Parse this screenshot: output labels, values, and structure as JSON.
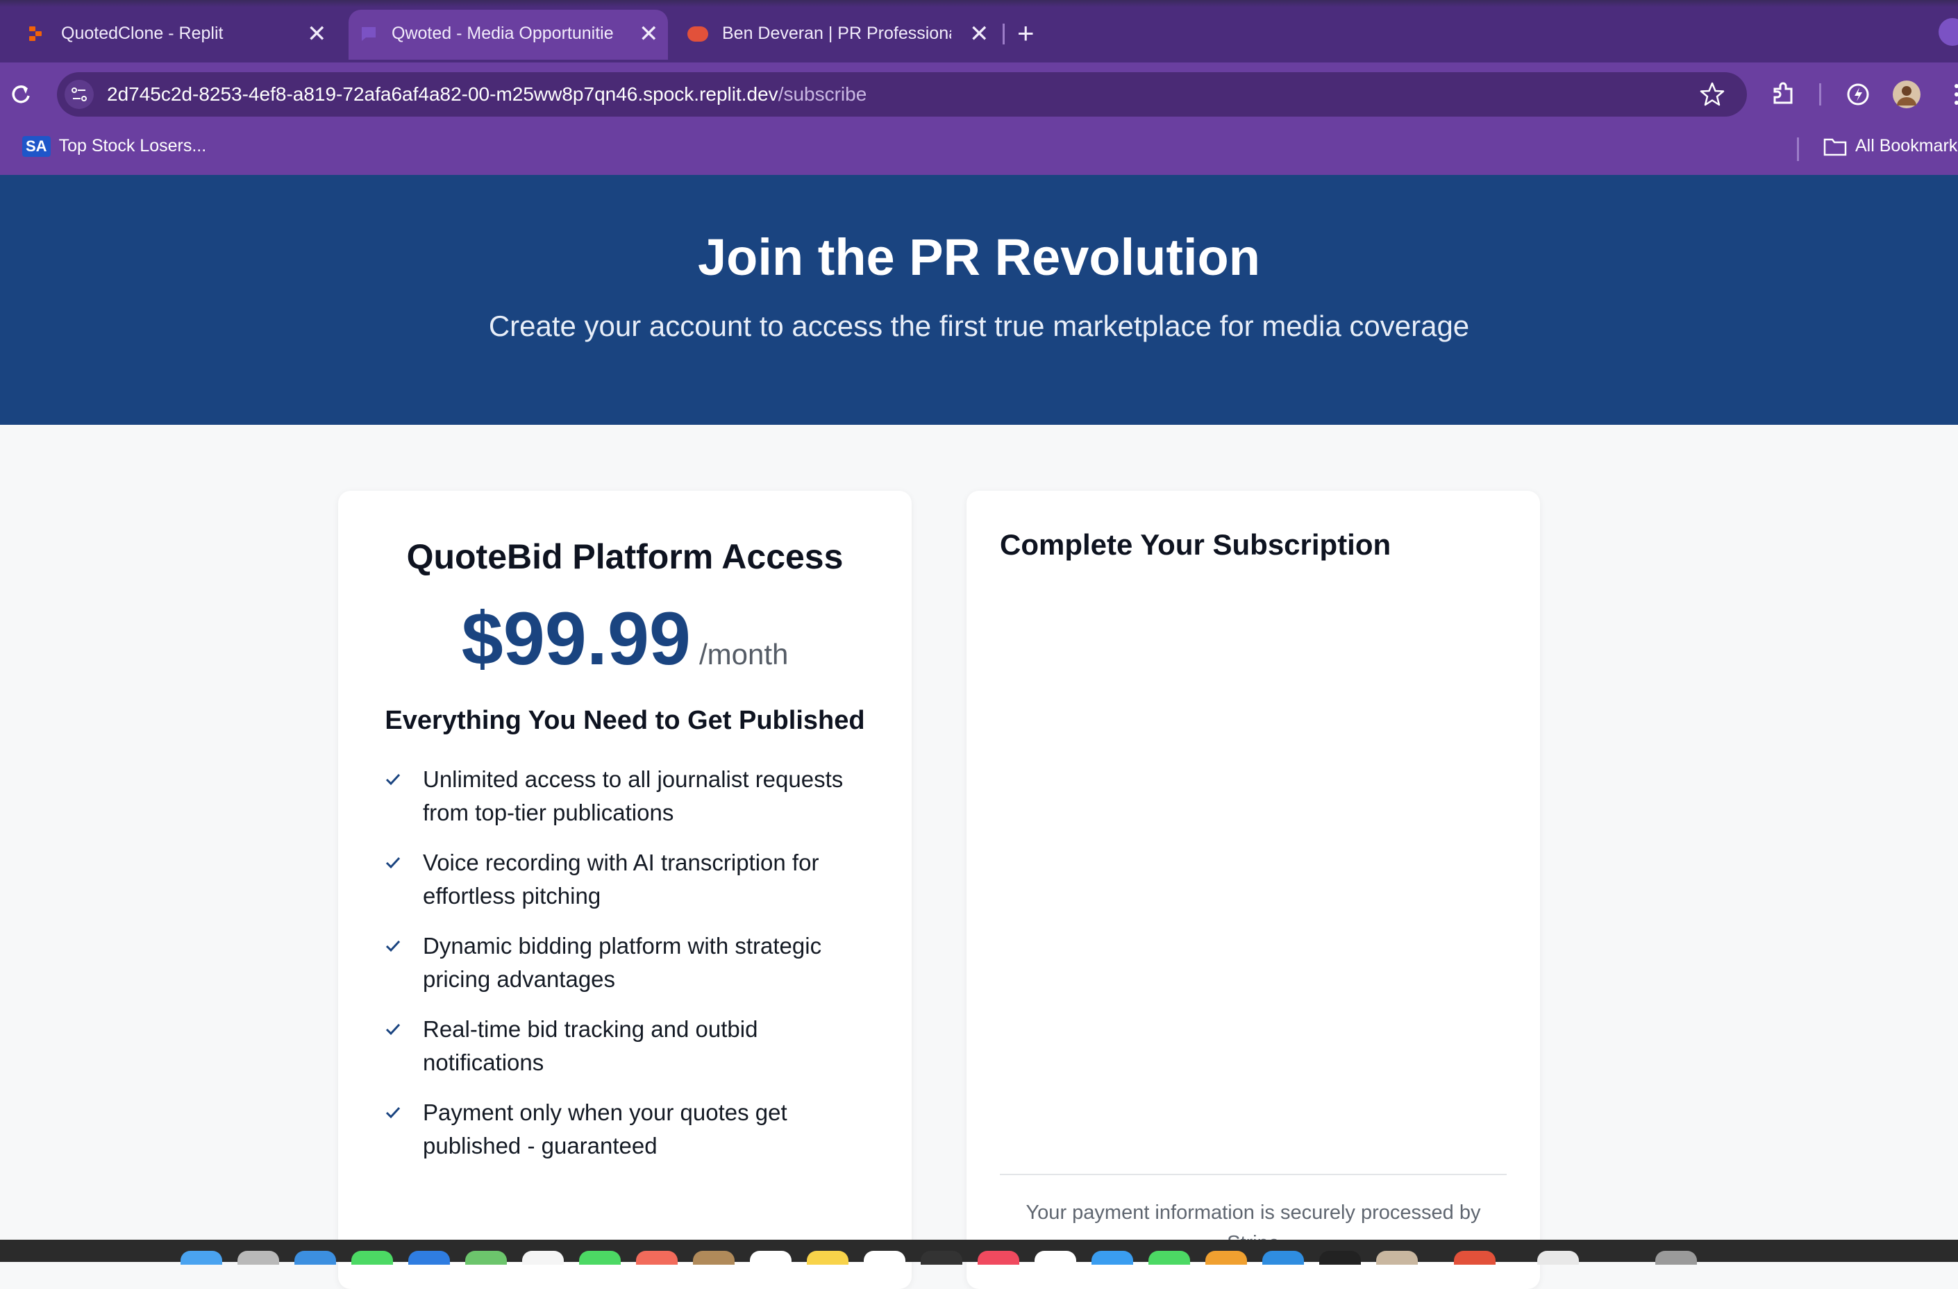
{
  "browser": {
    "tabs": [
      {
        "label": "QuotedClone - Replit",
        "active": false,
        "icon": "replit-icon"
      },
      {
        "label": "Qwoted - Media Opportunitie",
        "active": true,
        "icon": "chat-icon"
      },
      {
        "label": "Ben Deveran | PR Professiona",
        "active": false,
        "icon": "profile-icon"
      }
    ],
    "close_symbol": "✕",
    "new_tab_symbol": "+",
    "url_host": "2d745c2d-8253-4ef8-a819-72afa6af4a82-00-m25ww8p7qn46.spock.replit.dev",
    "url_path": "/subscribe",
    "bookmarks": {
      "item_badge": "SA",
      "item_label": "Top Stock Losers...",
      "all_bookmarks": "All Bookmark"
    }
  },
  "hero": {
    "title": "Join the PR Revolution",
    "subtitle": "Create your account to access the first true marketplace for media coverage"
  },
  "plan": {
    "title": "QuoteBid Platform Access",
    "price": "$99.99",
    "period": "/month",
    "features_title": "Everything You Need to Get Published",
    "features": [
      "Unlimited access to all journalist requests from top-tier publications",
      "Voice recording with AI transcription for effortless pitching",
      "Dynamic bidding platform with strategic pricing advantages",
      "Real-time bid tracking and outbid notifications",
      "Payment only when your quotes get published - guaranteed"
    ]
  },
  "subscription": {
    "title": "Complete Your Subscription",
    "secure_note": "Your payment information is securely processed by Stripe"
  },
  "colors": {
    "hero_bg": "#1a4480",
    "accent": "#1a4480",
    "browser_frame": "#6a3fa0"
  }
}
